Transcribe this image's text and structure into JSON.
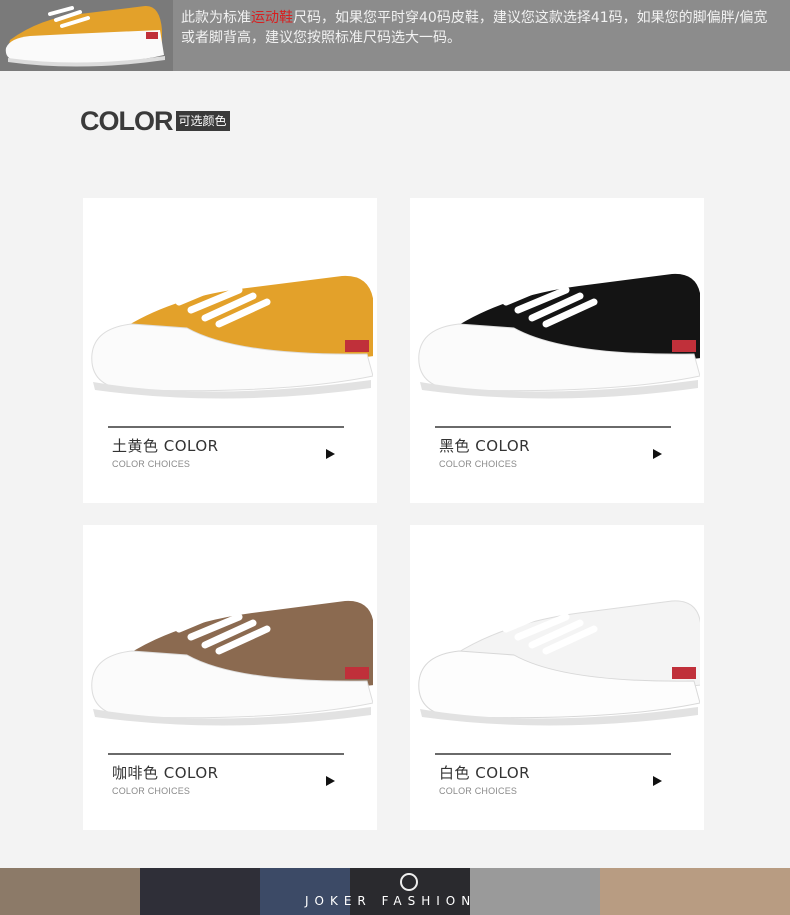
{
  "banner": {
    "text_before": "此款为标准",
    "text_highlight": "运动鞋",
    "text_after": "尺码，如果您平时穿40码皮鞋，建议您这款选择41码，如果您的脚偏胖/偏宽或者脚背高，建议您按照标准尺码选大一码。",
    "highlight_color": "#d81f1f"
  },
  "section": {
    "title": "COLOR",
    "tag": "可选颜色"
  },
  "colors": [
    {
      "name": "土黄色 COLOR",
      "sub": "COLOR CHOICES",
      "upper": "#e3a12a"
    },
    {
      "name": "黑色 COLOR",
      "sub": "COLOR CHOICES",
      "upper": "#141414"
    },
    {
      "name": "咖啡色 COLOR",
      "sub": "COLOR CHOICES",
      "upper": "#8b6a50"
    },
    {
      "name": "白色 COLOR",
      "sub": "COLOR CHOICES",
      "upper": "#f4f4f4"
    }
  ],
  "footer": {
    "brand": "JOKER FASHION"
  }
}
